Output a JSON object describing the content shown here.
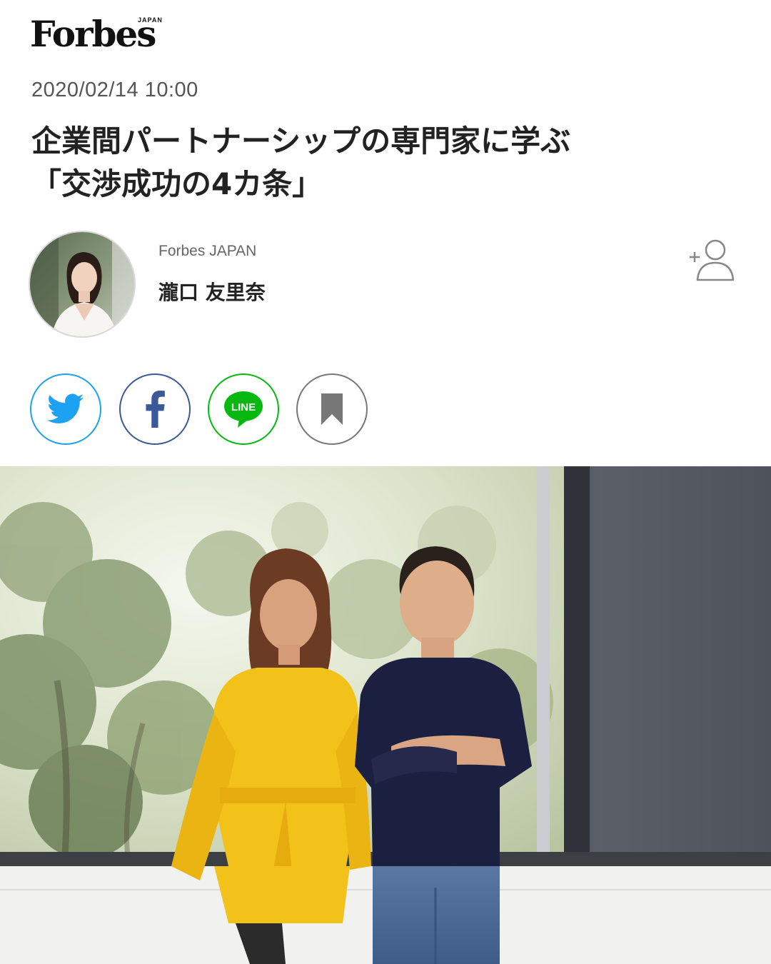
{
  "brand": {
    "logo_text": "Forbes",
    "logo_sub": "JAPAN"
  },
  "article": {
    "date": "2020/02/14 10:00",
    "title_lines": [
      "企業間パートナーシップの専門家に学ぶ",
      "「交渉成功の4カ条」"
    ]
  },
  "author": {
    "publication": "Forbes JAPAN",
    "name": "瀧口 友里奈"
  },
  "share": {
    "line_label": "LINE"
  },
  "icons": {
    "follow": "add-person-icon",
    "twitter": "twitter-bird-icon",
    "facebook": "facebook-f-icon",
    "line": "line-bubble-icon",
    "bookmark": "bookmark-icon"
  },
  "colors": {
    "twitter": "#1da1f2",
    "facebook": "#3b5998",
    "line": "#06b80f",
    "bookmark": "#777777",
    "dress": "#f2c21b",
    "shirt": "#1c2040"
  }
}
